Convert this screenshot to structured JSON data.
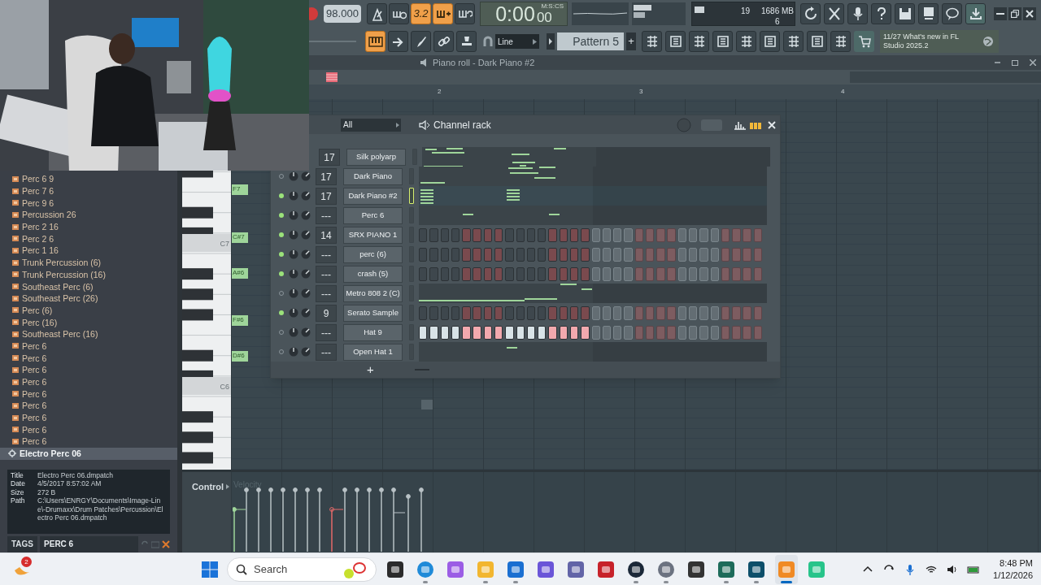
{
  "toolbar": {
    "tempo": "98.000",
    "transport_buttons": [
      {
        "kind": "metronome",
        "on": false
      },
      {
        "kind": "wait",
        "on": false
      },
      {
        "kind": "count",
        "label": "3.2",
        "on": true
      },
      {
        "kind": "blend",
        "on": true
      },
      {
        "kind": "loop",
        "on": false
      }
    ],
    "time": "0:00",
    "time_cs": "00",
    "time_unit": "M:S:CS",
    "cpu": "19",
    "memory": "1686 MB",
    "polyphony": "6",
    "tool_buttons": [
      {
        "kind": "keyboard",
        "on": true
      },
      {
        "kind": "arrow",
        "on": false
      },
      {
        "kind": "brush",
        "on": false
      },
      {
        "kind": "link",
        "on": false
      },
      {
        "kind": "stamp",
        "on": false
      }
    ],
    "snap": "Line",
    "pattern": "Pattern 5",
    "pattern_add": "+",
    "hint_count": "11/27",
    "hint_text": "What's new in FL Studio 2025.2"
  },
  "piano_roll": {
    "title": "Piano roll - Dark Piano #2",
    "bars": [
      "2",
      "3",
      "4"
    ],
    "octave_labels": [
      "C7",
      "C6"
    ],
    "ghost_notes": [
      "F7",
      "C#7",
      "A#6",
      "F#6",
      "D#6"
    ],
    "control_label": "Control",
    "control_target": "Velocity"
  },
  "browser": {
    "items": [
      {
        "label": "Perc 6 9",
        "kind": "folder",
        "selected": false
      },
      {
        "label": "Perc 7 6",
        "kind": "folder",
        "selected": false
      },
      {
        "label": "Perc 9 6",
        "kind": "folder",
        "selected": false
      },
      {
        "label": "Percussion 26",
        "kind": "folder",
        "selected": false
      },
      {
        "label": "Perc 2 16",
        "kind": "folder",
        "selected": false
      },
      {
        "label": "Perc 2 6",
        "kind": "folder",
        "selected": false
      },
      {
        "label": "Perc 1 16",
        "kind": "folder",
        "selected": false
      },
      {
        "label": "Trunk Percussion (6)",
        "kind": "folder",
        "selected": false
      },
      {
        "label": "Trunk Percussion (16)",
        "kind": "folder",
        "selected": false
      },
      {
        "label": "Southeast Perc (6)",
        "kind": "folder",
        "selected": false
      },
      {
        "label": "Southeast Perc (26)",
        "kind": "folder",
        "selected": false
      },
      {
        "label": "Perc (6)",
        "kind": "folder",
        "selected": false
      },
      {
        "label": "Perc (16)",
        "kind": "folder",
        "selected": false
      },
      {
        "label": "Southeast Perc (16)",
        "kind": "folder",
        "selected": false
      },
      {
        "label": "Perc 6",
        "kind": "folder",
        "selected": false
      },
      {
        "label": "Perc 6",
        "kind": "folder",
        "selected": false
      },
      {
        "label": "Perc 6",
        "kind": "folder",
        "selected": false
      },
      {
        "label": "Perc 6",
        "kind": "folder",
        "selected": false
      },
      {
        "label": "Perc 6",
        "kind": "folder",
        "selected": false
      },
      {
        "label": "Perc 6",
        "kind": "folder",
        "selected": false
      },
      {
        "label": "Perc 6",
        "kind": "folder",
        "selected": false
      },
      {
        "label": "Perc 6",
        "kind": "folder",
        "selected": false
      },
      {
        "label": "Perc 6",
        "kind": "folder",
        "selected": false
      },
      {
        "label": "Electro Perc 06",
        "kind": "patch",
        "selected": true
      }
    ],
    "info": [
      {
        "key": "Title",
        "value": "Electro Perc 06.dmpatch"
      },
      {
        "key": "Date",
        "value": "4/5/2017 8:57:02 AM"
      },
      {
        "key": "Size",
        "value": "272 B"
      },
      {
        "key": "Path",
        "value": "C:\\Users\\ENRGY\\Documents\\Image-Line\\-Drumaxx\\Drum Patches\\Percussion\\Electro Perc 06.dmpatch"
      }
    ],
    "tags_label": "TAGS",
    "tag": "PERC 6"
  },
  "channel_rack": {
    "filter": "All",
    "title": "Channel rack",
    "add": "+",
    "channels": [
      {
        "number": "17",
        "name": "Silk polyarp",
        "kind": "notes",
        "selected": false
      },
      {
        "number": "17",
        "name": "Dark Piano",
        "kind": "notes",
        "enabled": false,
        "selected": false
      },
      {
        "number": "17",
        "name": "Dark Piano #2",
        "kind": "notes",
        "enabled": true,
        "selected": true
      },
      {
        "number": "---",
        "name": "Perc 6",
        "kind": "notes",
        "enabled": true,
        "selected": false
      },
      {
        "number": "14",
        "name": "SRX PIANO 1",
        "kind": "steps",
        "enabled": true,
        "selected": false,
        "steps": [
          false,
          false,
          false,
          false,
          false,
          false,
          false,
          false,
          false,
          false,
          false,
          false,
          false,
          false,
          false,
          false
        ]
      },
      {
        "number": "---",
        "name": "perc (6)",
        "kind": "steps",
        "enabled": true,
        "selected": false,
        "steps": [
          false,
          false,
          false,
          false,
          false,
          false,
          false,
          false,
          false,
          false,
          false,
          false,
          false,
          false,
          false,
          false
        ]
      },
      {
        "number": "---",
        "name": "crash (5)",
        "kind": "steps",
        "enabled": true,
        "selected": false,
        "steps": [
          false,
          false,
          false,
          false,
          false,
          false,
          false,
          false,
          false,
          false,
          false,
          false,
          false,
          false,
          false,
          false
        ]
      },
      {
        "number": "---",
        "name": "Metro 808 2 (C)",
        "kind": "notes",
        "enabled": false,
        "selected": false
      },
      {
        "number": "9",
        "name": "Serato Sample",
        "kind": "steps",
        "enabled": true,
        "selected": false,
        "steps": [
          false,
          false,
          false,
          false,
          false,
          false,
          false,
          false,
          false,
          false,
          false,
          false,
          false,
          false,
          false,
          false
        ]
      },
      {
        "number": "---",
        "name": "Hat 9",
        "kind": "steps",
        "enabled": false,
        "selected": false,
        "steps": [
          true,
          true,
          true,
          true,
          true,
          true,
          true,
          true,
          true,
          true,
          true,
          true,
          true,
          true,
          true,
          true
        ]
      },
      {
        "number": "---",
        "name": "Open Hat 1",
        "kind": "notes",
        "enabled": false,
        "selected": false
      }
    ]
  },
  "taskbar": {
    "weather_badge": "2",
    "search_placeholder": "Search",
    "apps": [
      {
        "kind": "taskview",
        "running": false,
        "selected": false
      },
      {
        "kind": "edge",
        "running": true,
        "selected": false
      },
      {
        "kind": "copilot",
        "running": false,
        "selected": false
      },
      {
        "kind": "explorer",
        "running": true,
        "selected": false
      },
      {
        "kind": "mail",
        "running": true,
        "selected": false
      },
      {
        "kind": "notes",
        "running": false,
        "selected": false
      },
      {
        "kind": "teams",
        "running": false,
        "selected": false
      },
      {
        "kind": "game",
        "running": false,
        "selected": false
      },
      {
        "kind": "steam",
        "running": true,
        "selected": false
      },
      {
        "kind": "settings",
        "running": true,
        "selected": false
      },
      {
        "kind": "alien",
        "running": false,
        "selected": false
      },
      {
        "kind": "capture",
        "running": true,
        "selected": false
      },
      {
        "kind": "terminal",
        "running": true,
        "selected": false
      },
      {
        "kind": "fl",
        "running": true,
        "selected": true
      },
      {
        "kind": "chat",
        "running": false,
        "selected": false
      }
    ],
    "time": "8:48 PM",
    "date": "1/12/2026"
  }
}
